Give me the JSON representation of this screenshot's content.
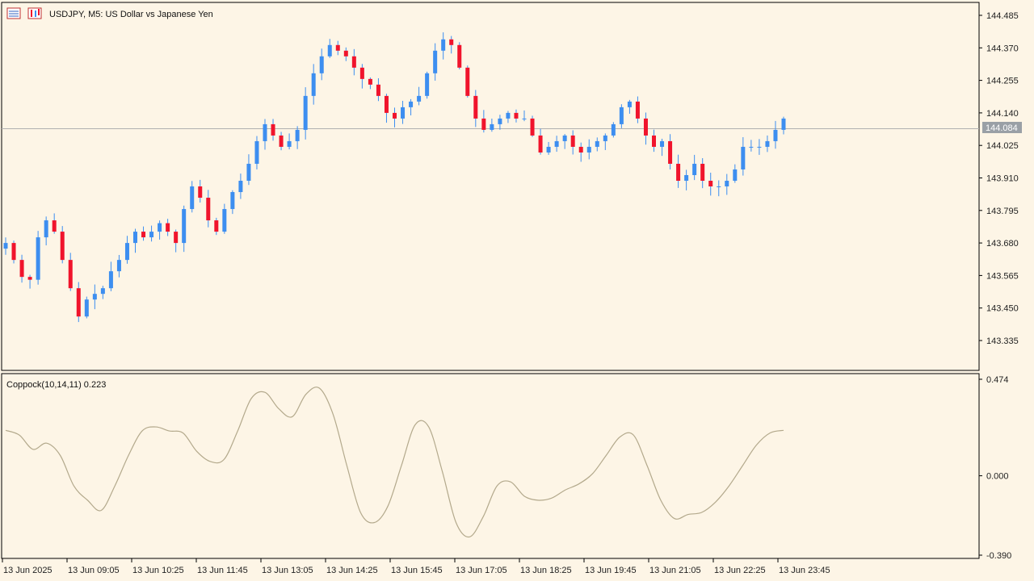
{
  "window": {
    "symbol_title": "USDJPY, M5:  US Dollar vs Japanese Yen"
  },
  "main_chart": {
    "price_labels": [
      "144.485",
      "144.370",
      "144.255",
      "144.140",
      "144.025",
      "143.910",
      "143.795",
      "143.680",
      "143.565",
      "143.450",
      "143.335"
    ],
    "price_values": [
      144.485,
      144.37,
      144.255,
      144.14,
      144.025,
      143.91,
      143.795,
      143.68,
      143.565,
      143.45,
      143.335
    ],
    "current_price_label": "144.084",
    "current_price": 144.084,
    "up_color": "#3d8ef0",
    "down_color": "#f0142c",
    "doji_color": "#2ecc40",
    "wick_color": "#3d8ef0",
    "price_line_color": "#b0b0b0"
  },
  "indicator": {
    "title": "Coppock(10,14,11) 0.223",
    "labels": [
      "0.474",
      "0.000",
      "-0.390"
    ],
    "values": [
      0.474,
      0.0,
      -0.39
    ],
    "line_color": "#b3a98c"
  },
  "time_axis": {
    "labels": [
      "13 Jun 2025",
      "13 Jun 09:05",
      "13 Jun 10:25",
      "13 Jun 11:45",
      "13 Jun 13:05",
      "13 Jun 14:25",
      "13 Jun 15:45",
      "13 Jun 17:05",
      "13 Jun 18:25",
      "13 Jun 19:45",
      "13 Jun 21:05",
      "13 Jun 22:25",
      "13 Jun 23:45"
    ]
  },
  "chart_data": {
    "type": "line",
    "title": "",
    "description_series": [
      {
        "name": "USDJPY",
        "kind": "candlestick-close-approx",
        "values": [
          143.68,
          143.62,
          143.56,
          143.55,
          143.7,
          143.76,
          143.72,
          143.62,
          143.52,
          143.42,
          143.48,
          143.5,
          143.52,
          143.58,
          143.62,
          143.68,
          143.72,
          143.7,
          143.72,
          143.75,
          143.72,
          143.68,
          143.8,
          143.88,
          143.84,
          143.76,
          143.72,
          143.8,
          143.86,
          143.9,
          143.96,
          144.04,
          144.1,
          144.06,
          144.02,
          144.04,
          144.08,
          144.2,
          144.28,
          144.34,
          144.38,
          144.36,
          144.34,
          144.3,
          144.26,
          144.24,
          144.2,
          144.14,
          144.12,
          144.16,
          144.18,
          144.2,
          144.28,
          144.36,
          144.4,
          144.38,
          144.3,
          144.2,
          144.12,
          144.08,
          144.1,
          144.12,
          144.14,
          144.12,
          144.12,
          144.06,
          144.0,
          144.02,
          144.04,
          144.06,
          144.02,
          144.0,
          144.02,
          144.04,
          144.06,
          144.1,
          144.16,
          144.18,
          144.12,
          144.06,
          144.02,
          144.04,
          143.96,
          143.9,
          143.92,
          143.96,
          143.9,
          143.88,
          143.88,
          143.9,
          143.94,
          144.02,
          144.02,
          144.02,
          144.04,
          144.08,
          144.12
        ]
      },
      {
        "name": "Coppock(10,14,11)",
        "kind": "indicator",
        "values": [
          0.223,
          0.2,
          0.13,
          0.16,
          0.1,
          -0.05,
          -0.12,
          -0.17,
          -0.05,
          0.1,
          0.22,
          0.24,
          0.22,
          0.21,
          0.12,
          0.07,
          0.08,
          0.22,
          0.38,
          0.41,
          0.33,
          0.29,
          0.4,
          0.43,
          0.3,
          0.05,
          -0.18,
          -0.23,
          -0.15,
          0.05,
          0.25,
          0.24,
          0.02,
          -0.23,
          -0.3,
          -0.2,
          -0.05,
          -0.03,
          -0.1,
          -0.12,
          -0.11,
          -0.07,
          -0.04,
          0.01,
          0.1,
          0.19,
          0.2,
          0.05,
          -0.12,
          -0.21,
          -0.19,
          -0.18,
          -0.13,
          -0.05,
          0.05,
          0.15,
          0.21,
          0.223
        ]
      }
    ],
    "ylim_main": [
      143.335,
      144.485
    ],
    "ylim_indicator": [
      -0.39,
      0.474
    ],
    "grid": false
  }
}
